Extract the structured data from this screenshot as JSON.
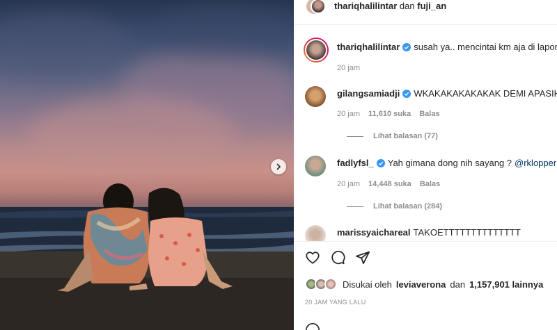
{
  "post": {
    "carousel_next_label": "Next"
  },
  "header": {
    "user1": "thariqhalilintar",
    "conjunction": "dan",
    "user2": "fuji_an"
  },
  "comments": [
    {
      "username": "thariqhalilintar",
      "verified": true,
      "text": "susah ya.. mencintai km aja di laporin",
      "time": "20 jam",
      "likes": "",
      "reply": ""
    },
    {
      "username": "gilangsamiadji",
      "verified": true,
      "text": "WKAKAKAKAKAKAK DEMI APASIH",
      "time": "20 jam",
      "likes": "11,610 suka",
      "reply": "Balas",
      "view_replies": "Lihat balasan (77)"
    },
    {
      "username": "fadlyfsl_",
      "verified": true,
      "text": "Yah gimana dong nih sayang ?",
      "mention": "@rklopperr",
      "time": "20 jam",
      "likes": "14,448 suka",
      "reply": "Balas",
      "view_replies": "Lihat balasan (284)"
    },
    {
      "username": "marissyaichareal",
      "verified": false,
      "text": "TAKOETTTTTTTTTTTTTT"
    }
  ],
  "likes": {
    "prefix": "Disukai oleh",
    "user": "leviaverona",
    "and": "dan",
    "count": "1,157,901 lainnya"
  },
  "timestamp": "20 JAM YANG LALU",
  "icons": {
    "like": "heart-icon",
    "comment": "comment-icon",
    "share": "share-icon",
    "verified": "verified-badge-icon",
    "next": "chevron-right-icon",
    "emoji": "emoji-icon"
  },
  "colors": {
    "verified": "#3897f0",
    "text": "#262626",
    "muted": "#8e8e8e",
    "mention": "#00376b"
  }
}
